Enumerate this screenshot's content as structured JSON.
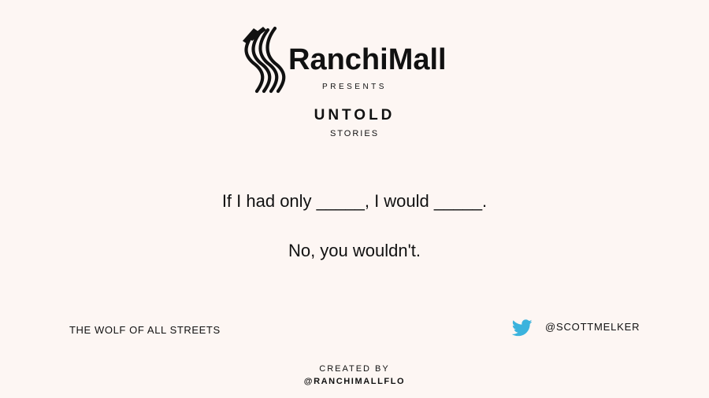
{
  "brand": {
    "name": "RanchiMall",
    "logo_icon": "ranchimall-logo-icon",
    "presents": "PRESENTS"
  },
  "series": {
    "title": "UNTOLD",
    "subtitle": "STORIES"
  },
  "quote": {
    "line1": "If I had only _____, I would _____.",
    "line2": "No, you wouldn't."
  },
  "author": {
    "name": "THE WOLF OF ALL STREETS",
    "twitter_icon": "twitter-icon",
    "handle": "@SCOTTMELKER"
  },
  "credits": {
    "label": "CREATED BY",
    "handle": "@RANCHIMALLFLO"
  },
  "colors": {
    "background": "#fdf6f3",
    "text": "#111111",
    "twitter": "#3bb3dd"
  }
}
